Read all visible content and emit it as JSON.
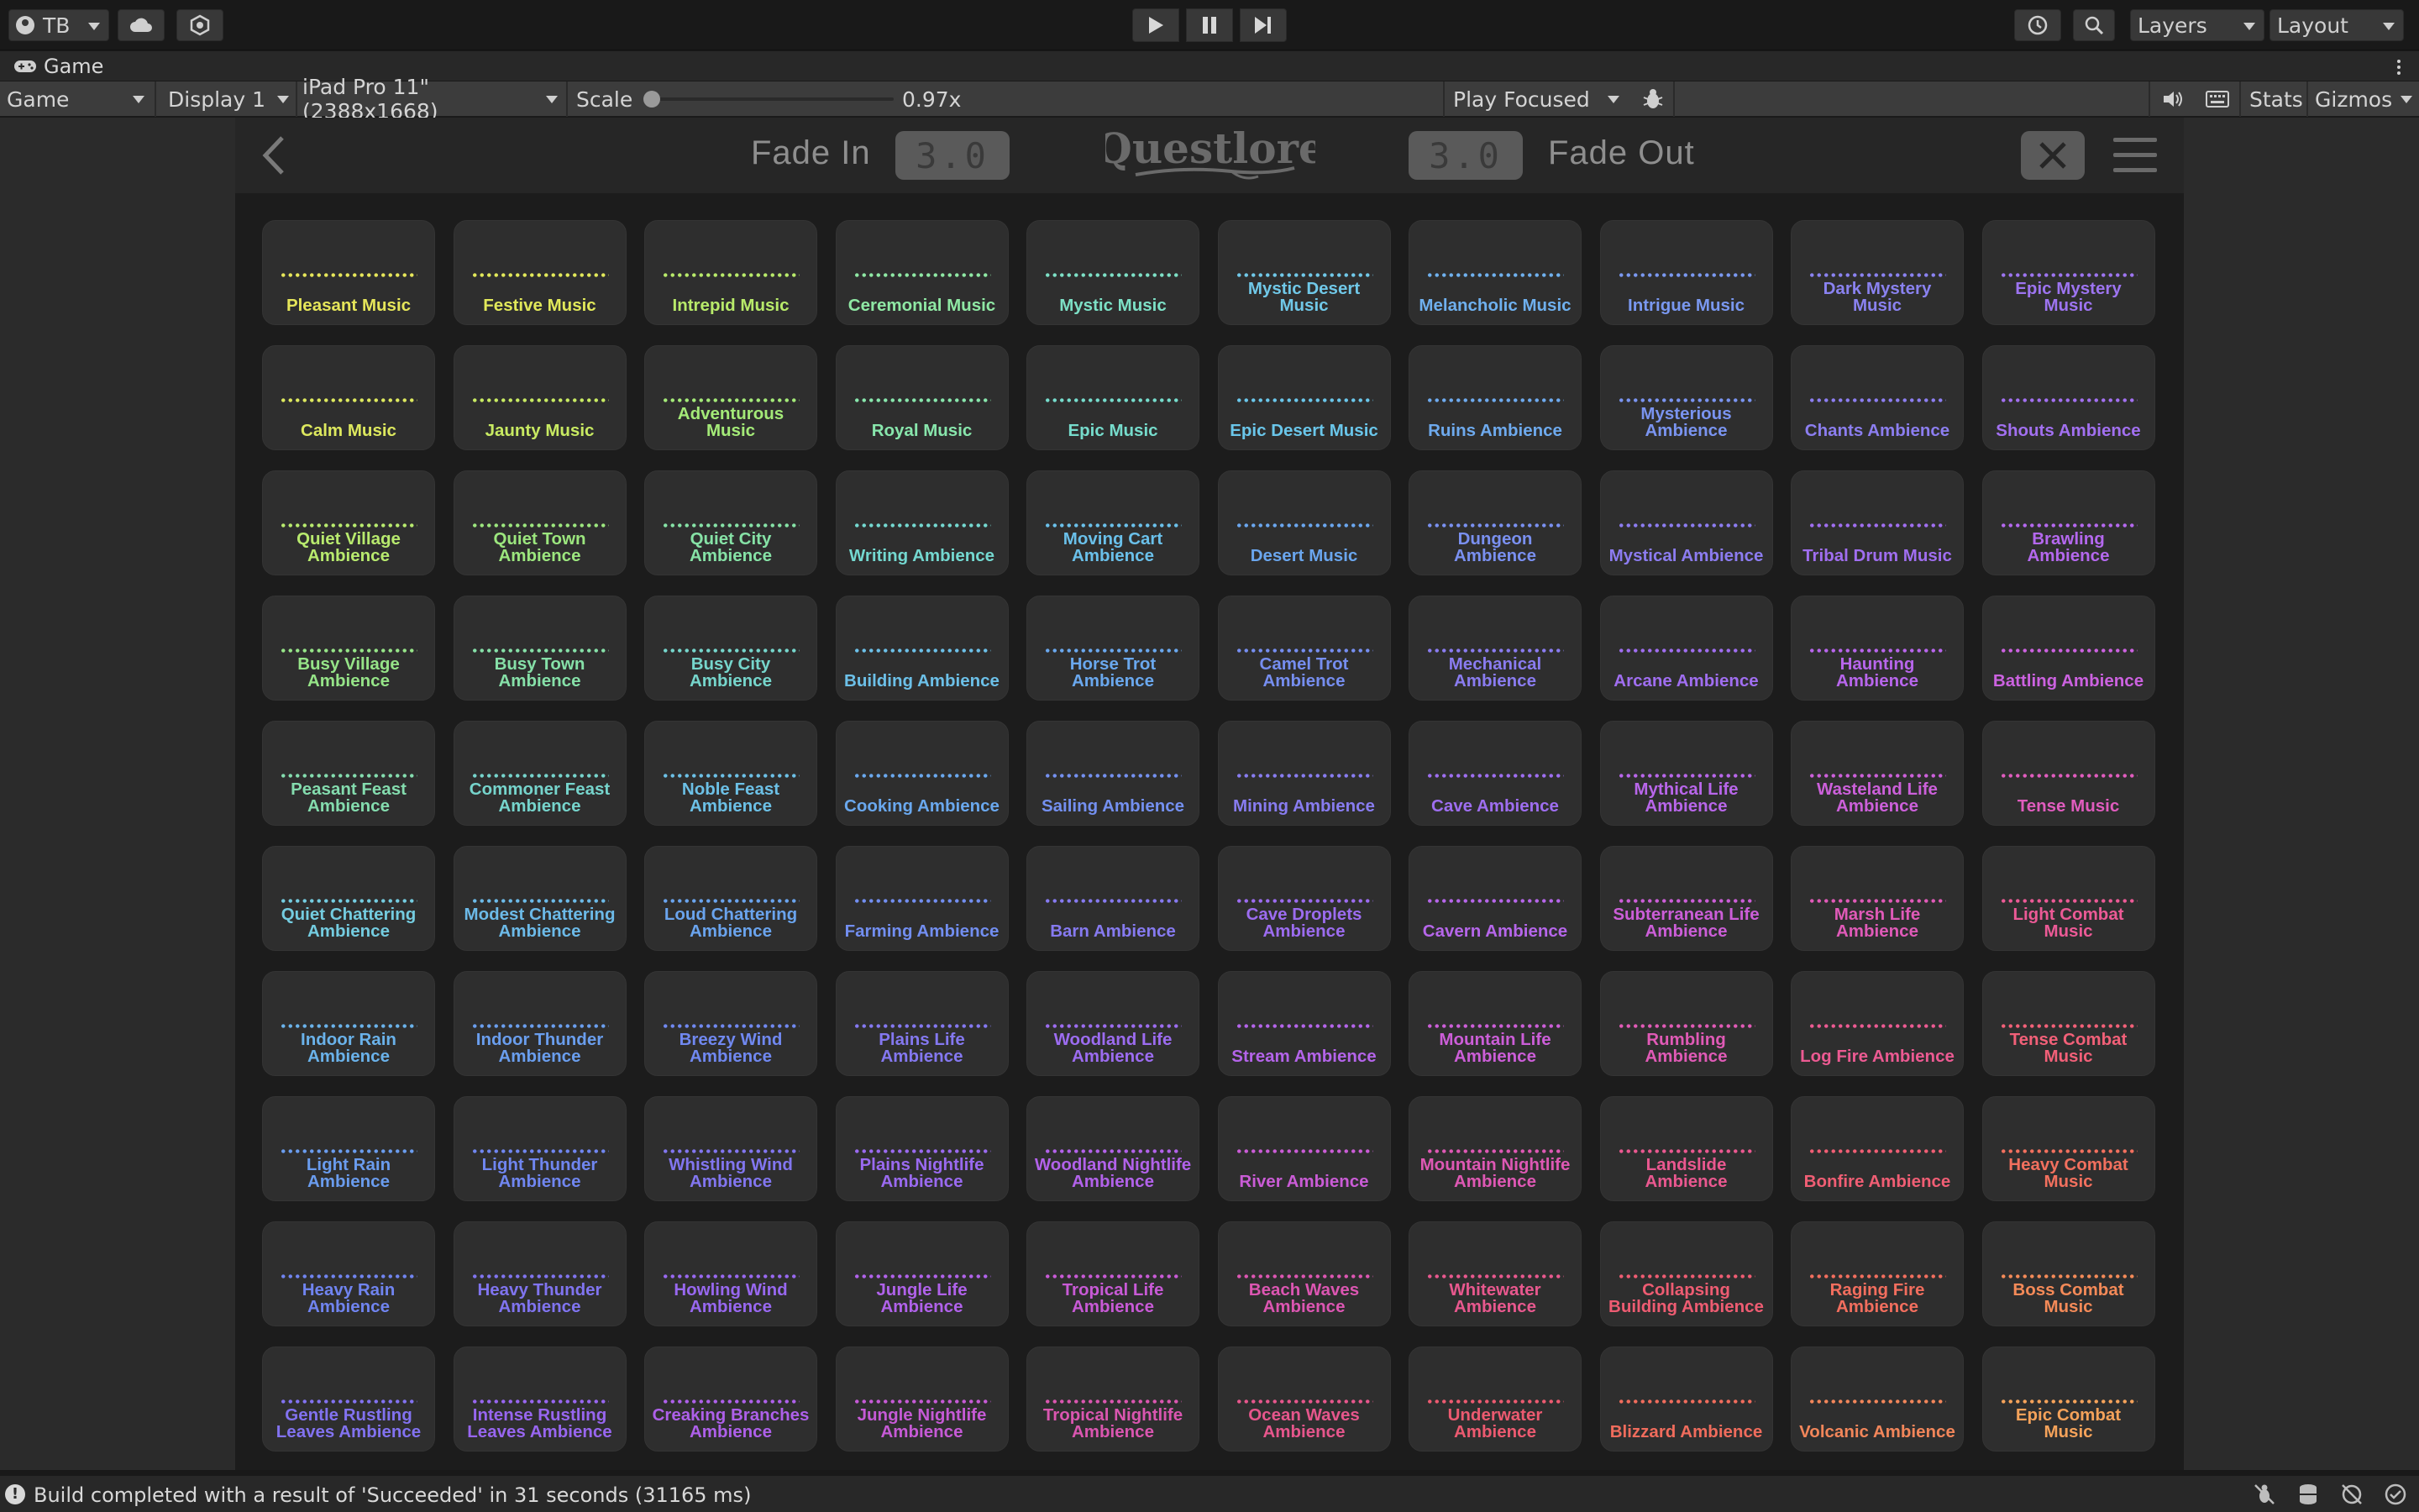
{
  "toolbar": {
    "account_label": "TB",
    "layers_label": "Layers",
    "layout_label": "Layout"
  },
  "tab": {
    "title": "Game"
  },
  "controls": {
    "view_mode": "Game",
    "display": "Display 1",
    "resolution": "iPad Pro 11\" (2388x1668)",
    "scale_label": "Scale",
    "scale_value": "0.97x",
    "play_mode": "Play Focused",
    "stats_label": "Stats",
    "gizmos_label": "Gizmos"
  },
  "game": {
    "fade_in_label": "Fade In",
    "fade_in_value": "3.0",
    "fade_out_label": "Fade Out",
    "fade_out_value": "3.0",
    "logo_text": "Questlore"
  },
  "tiles": [
    {
      "label": "Pleasant Music",
      "color": "#e6e65a"
    },
    {
      "label": "Festive Music",
      "color": "#e1e85a"
    },
    {
      "label": "Intrepid Music",
      "color": "#b8ea6a"
    },
    {
      "label": "Ceremonial Music",
      "color": "#8fe8a4"
    },
    {
      "label": "Mystic Music",
      "color": "#7de0c6"
    },
    {
      "label": "Mystic Desert Music",
      "color": "#70c8e8"
    },
    {
      "label": "Melancholic Music",
      "color": "#6fb0ee"
    },
    {
      "label": "Intrigue Music",
      "color": "#7a98f0"
    },
    {
      "label": "Dark Mystery Music",
      "color": "#8a82f0"
    },
    {
      "label": "Epic Mystery Music",
      "color": "#9d74f0"
    },
    {
      "label": "Calm Music",
      "color": "#dde85e"
    },
    {
      "label": "Jaunty Music",
      "color": "#c8ea62"
    },
    {
      "label": "Adventurous Music",
      "color": "#a4ea78"
    },
    {
      "label": "Royal Music",
      "color": "#88e6ac"
    },
    {
      "label": "Epic Music",
      "color": "#76dccc"
    },
    {
      "label": "Epic Desert Music",
      "color": "#6ac6ea"
    },
    {
      "label": "Ruins Ambience",
      "color": "#6eaaee"
    },
    {
      "label": "Mysterious Ambience",
      "color": "#7a94f0"
    },
    {
      "label": "Chants Ambience",
      "color": "#8c7ef0"
    },
    {
      "label": "Shouts Ambience",
      "color": "#a270f0"
    },
    {
      "label": "Quiet Village Ambience",
      "color": "#b8ea6e"
    },
    {
      "label": "Quiet Town Ambience",
      "color": "#9ce67e"
    },
    {
      "label": "Quiet City Ambience",
      "color": "#86e2a6"
    },
    {
      "label": "Writing Ambience",
      "color": "#74d8d0"
    },
    {
      "label": "Moving Cart Ambience",
      "color": "#6ac0ea"
    },
    {
      "label": "Desert Music",
      "color": "#6aa6ee"
    },
    {
      "label": "Dungeon Ambience",
      "color": "#7a90f0"
    },
    {
      "label": "Mystical Ambience",
      "color": "#8c7cf0"
    },
    {
      "label": "Tribal Drum Music",
      "color": "#a06ef0"
    },
    {
      "label": "Brawling Ambience",
      "color": "#b468ee"
    },
    {
      "label": "Busy Village Ambience",
      "color": "#96e488"
    },
    {
      "label": "Busy Town Ambience",
      "color": "#86e0a8"
    },
    {
      "label": "Busy City Ambience",
      "color": "#76d6cc"
    },
    {
      "label": "Building Ambience",
      "color": "#6cc0e8"
    },
    {
      "label": "Horse Trot Ambience",
      "color": "#6aa8ee"
    },
    {
      "label": "Camel Trot Ambience",
      "color": "#768ef0"
    },
    {
      "label": "Mechanical Ambience",
      "color": "#8a7cf0"
    },
    {
      "label": "Arcane Ambience",
      "color": "#a06ef0"
    },
    {
      "label": "Haunting Ambience",
      "color": "#b866ec"
    },
    {
      "label": "Battling Ambience",
      "color": "#cc62e0"
    },
    {
      "label": "Peasant Feast Ambience",
      "color": "#84dcae"
    },
    {
      "label": "Commoner Feast Ambience",
      "color": "#76d4cc"
    },
    {
      "label": "Noble Feast Ambience",
      "color": "#6cc0e6"
    },
    {
      "label": "Cooking Ambience",
      "color": "#6aa8ee"
    },
    {
      "label": "Sailing Ambience",
      "color": "#7490f0"
    },
    {
      "label": "Mining Ambience",
      "color": "#887cf0"
    },
    {
      "label": "Cave Ambience",
      "color": "#9e6ef0"
    },
    {
      "label": "Mythical Life Ambience",
      "color": "#b866ea"
    },
    {
      "label": "Wasteland Life Ambience",
      "color": "#cc60da"
    },
    {
      "label": "Tense Music",
      "color": "#e05cbe"
    },
    {
      "label": "Quiet Chattering Ambience",
      "color": "#74cce0"
    },
    {
      "label": "Modest Chattering Ambience",
      "color": "#6cbae8"
    },
    {
      "label": "Loud Chattering Ambience",
      "color": "#6aa4ee"
    },
    {
      "label": "Farming Ambience",
      "color": "#728ef0"
    },
    {
      "label": "Barn Ambience",
      "color": "#867af0"
    },
    {
      "label": "Cave Droplets Ambience",
      "color": "#9c6cf0"
    },
    {
      "label": "Cavern Ambience",
      "color": "#b666ea"
    },
    {
      "label": "Subterranean Life Ambience",
      "color": "#cc5ed8"
    },
    {
      "label": "Marsh Life Ambience",
      "color": "#e05ab8"
    },
    {
      "label": "Light Combat Music",
      "color": "#ec5a96"
    },
    {
      "label": "Indoor Rain Ambience",
      "color": "#6ab2ea"
    },
    {
      "label": "Indoor Thunder Ambience",
      "color": "#6a9eee"
    },
    {
      "label": "Breezy Wind Ambience",
      "color": "#7088f0"
    },
    {
      "label": "Plains Life Ambience",
      "color": "#8478f0"
    },
    {
      "label": "Woodland Life Ambience",
      "color": "#9c6cf0"
    },
    {
      "label": "Stream Ambience",
      "color": "#b464ea"
    },
    {
      "label": "Mountain Life Ambience",
      "color": "#cc5ed8"
    },
    {
      "label": "Rumbling Ambience",
      "color": "#e05ab6"
    },
    {
      "label": "Log Fire Ambience",
      "color": "#ec5a92"
    },
    {
      "label": "Tense Combat Music",
      "color": "#f26078"
    },
    {
      "label": "Light Rain Ambience",
      "color": "#6a9cee"
    },
    {
      "label": "Light Thunder Ambience",
      "color": "#7086f0"
    },
    {
      "label": "Whistling Wind Ambience",
      "color": "#8276f0"
    },
    {
      "label": "Plains Nightlife Ambience",
      "color": "#9a6af0"
    },
    {
      "label": "Woodland Nightlife Ambience",
      "color": "#b262ea"
    },
    {
      "label": "River Ambience",
      "color": "#ca5cd6"
    },
    {
      "label": "Mountain Nightlife Ambience",
      "color": "#de58b4"
    },
    {
      "label": "Landslide Ambience",
      "color": "#ea5890"
    },
    {
      "label": "Bonfire Ambience",
      "color": "#f05e74"
    },
    {
      "label": "Heavy Combat Music",
      "color": "#f2705e"
    },
    {
      "label": "Heavy Rain Ambience",
      "color": "#7084f0"
    },
    {
      "label": "Heavy Thunder Ambience",
      "color": "#8074f0"
    },
    {
      "label": "Howling Wind Ambience",
      "color": "#9868f0"
    },
    {
      "label": "Jungle Life Ambience",
      "color": "#b062ea"
    },
    {
      "label": "Tropical Life Ambience",
      "color": "#c85ad6"
    },
    {
      "label": "Beach Waves Ambience",
      "color": "#dc56b2"
    },
    {
      "label": "Whitewater Ambience",
      "color": "#e8588e"
    },
    {
      "label": "Collapsing Building Ambience",
      "color": "#ee5c72"
    },
    {
      "label": "Raging Fire Ambience",
      "color": "#f26e5e"
    },
    {
      "label": "Boss Combat Music",
      "color": "#f48a58"
    },
    {
      "label": "Gentle Rustling Leaves Ambience",
      "color": "#8272f0"
    },
    {
      "label": "Intense Rustling Leaves Ambience",
      "color": "#9866f0"
    },
    {
      "label": "Creaking Branches Ambience",
      "color": "#ae60ea"
    },
    {
      "label": "Jungle Nightlife Ambience",
      "color": "#c65ad6"
    },
    {
      "label": "Tropical Nightlife Ambience",
      "color": "#da56b0"
    },
    {
      "label": "Ocean Waves Ambience",
      "color": "#e6568c"
    },
    {
      "label": "Underwater Ambience",
      "color": "#ec5a70"
    },
    {
      "label": "Blizzard Ambience",
      "color": "#f06c5c"
    },
    {
      "label": "Volcanic Ambience",
      "color": "#f2865a"
    },
    {
      "label": "Epic Combat Music",
      "color": "#f4a25a"
    }
  ],
  "status": {
    "message": "Build completed with a result of 'Succeeded' in 31 seconds (31165 ms)"
  }
}
